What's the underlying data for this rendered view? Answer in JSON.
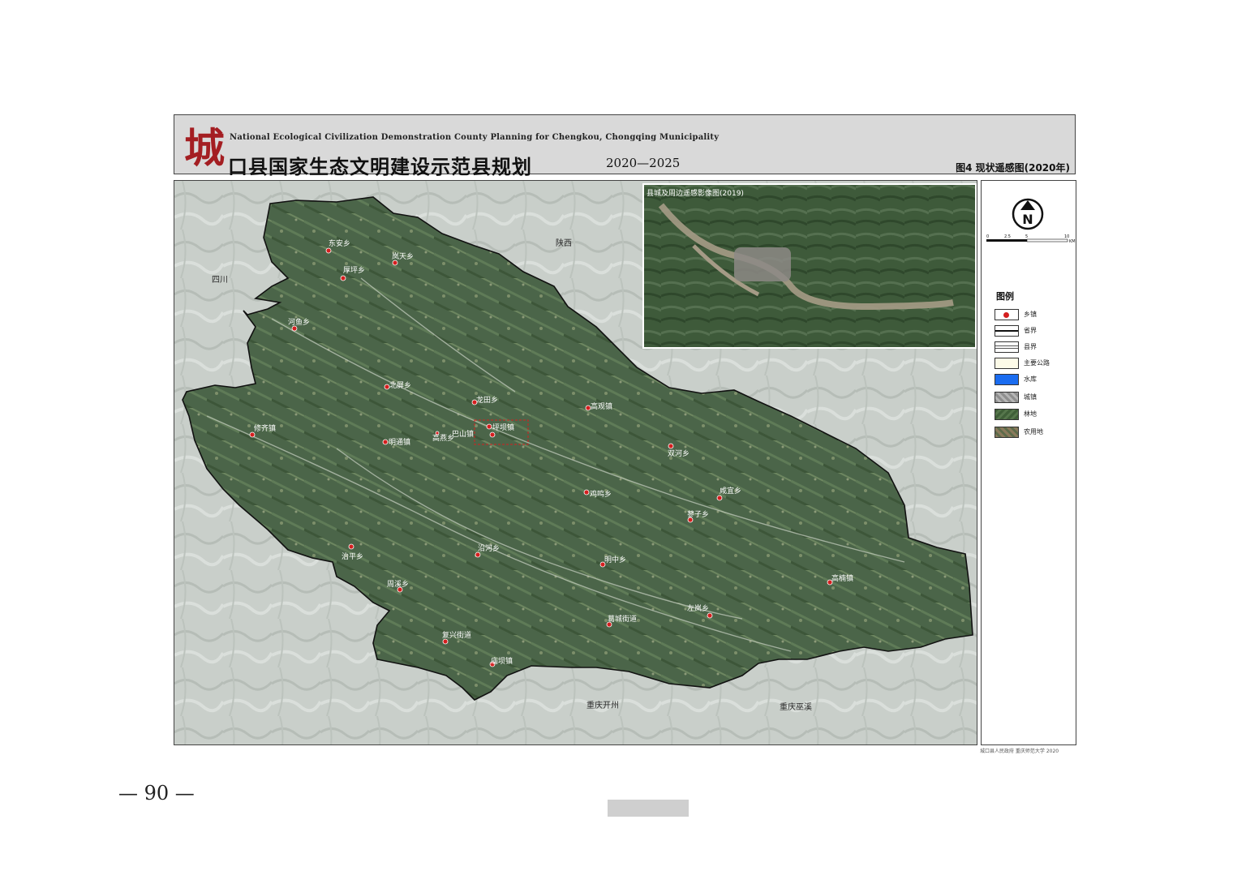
{
  "header": {
    "logo_char": "城",
    "subtitle_en": "National Ecological Civilization Demonstration County Planning for Chengkou, Chongqing Municipality",
    "title_cn": "口县国家生态文明建设示范县规划",
    "years": "2020—2025",
    "figure_title": "图4  现状遥感图(2020年)"
  },
  "map": {
    "regions": [
      {
        "name": "陕西"
      },
      {
        "name": "四川"
      },
      {
        "name": "重庆开州"
      },
      {
        "name": "重庆巫溪"
      }
    ],
    "towns": [
      {
        "name": "东安乡"
      },
      {
        "name": "岚天乡"
      },
      {
        "name": "厚坪乡"
      },
      {
        "name": "河鱼乡"
      },
      {
        "name": "北屏乡"
      },
      {
        "name": "龙田乡"
      },
      {
        "name": "高观镇"
      },
      {
        "name": "坪坝镇"
      },
      {
        "name": "巴山镇"
      },
      {
        "name": "修齐镇"
      },
      {
        "name": "明通镇"
      },
      {
        "name": "双河乡"
      },
      {
        "name": "鸡鸣乡"
      },
      {
        "name": "咸宜乡"
      },
      {
        "name": "蓼子乡"
      },
      {
        "name": "治平乡"
      },
      {
        "name": "沿河乡"
      },
      {
        "name": "明中乡"
      },
      {
        "name": "高楠镇"
      },
      {
        "name": "周溪乡"
      },
      {
        "name": "左岚乡"
      },
      {
        "name": "葛城街道"
      },
      {
        "name": "复兴街道"
      },
      {
        "name": "庙坝镇"
      },
      {
        "name": "高燕乡"
      }
    ],
    "inset_title": "县城及周边遥感影像图(2019)",
    "colors": {
      "forest": "#4a6a4a",
      "town_dot": "#d41f1f",
      "boundary": "#111111"
    }
  },
  "legend": {
    "north_symbol": "N",
    "scale_ticks": [
      "0",
      "2.5",
      "5",
      "10"
    ],
    "scale_unit": "KM",
    "title": "图例",
    "items": [
      {
        "label": "乡镇",
        "icon": "town-dot"
      },
      {
        "label": "省界",
        "icon": "province-boundary"
      },
      {
        "label": "县界",
        "icon": "county-boundary"
      },
      {
        "label": "主要公路",
        "icon": "main-road"
      },
      {
        "label": "水库",
        "icon": "reservoir",
        "color": "#1a6cf0"
      },
      {
        "label": "城镇",
        "icon": "urban-area"
      },
      {
        "label": "林地",
        "icon": "forest-land",
        "color": "#3f5f38"
      },
      {
        "label": "农用地",
        "icon": "farmland"
      }
    ]
  },
  "credit": "城口县人民政府 重庆师范大学 2020",
  "page_number": "— 90 —"
}
